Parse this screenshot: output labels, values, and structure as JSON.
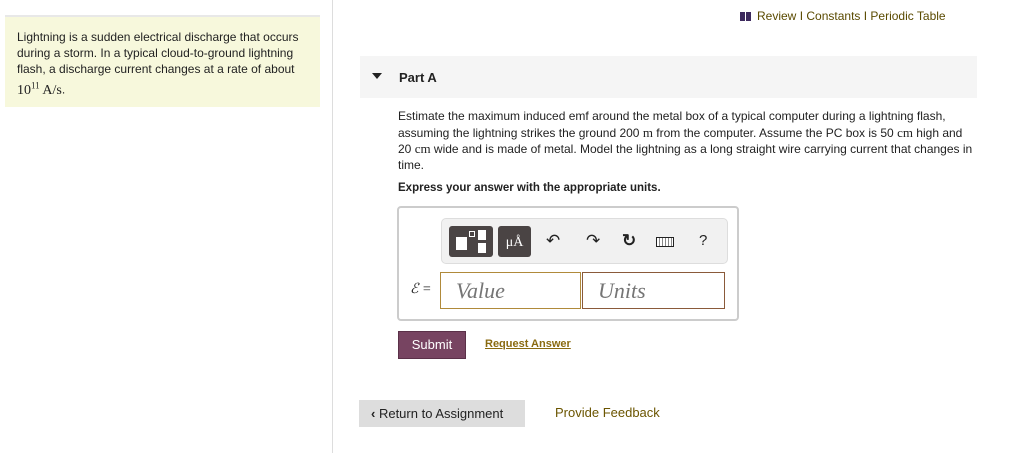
{
  "intro": {
    "text": "Lightning is a sudden electrical discharge that occurs during a storm. In a typical cloud-to-ground lightning flash, a discharge current changes at a rate of about ",
    "math_base": "10",
    "math_exp": "11",
    "math_unit": " A/s",
    "tail": "."
  },
  "toplinks": {
    "review": "Review",
    "sep": " I ",
    "constants": "Constants",
    "periodic": "Periodic Table"
  },
  "part": {
    "title": "Part A"
  },
  "question": {
    "p1": "Estimate the maximum induced emf around the metal box of a typical computer during a lightning flash, assuming the lightning strikes the ground 200 ",
    "u1": "m",
    "p2": " from the computer. Assume the PC box is 50 ",
    "u2": "cm",
    "p3": " high and 20 ",
    "u3": "cm",
    "p4": " wide and is made of metal. Model the lightning as a long straight wire carrying current that changes in time."
  },
  "express": "Express your answer with the appropriate units.",
  "toolbar": {
    "units_label": "μÅ",
    "help": "?"
  },
  "answer": {
    "label": "ℰ =",
    "value_placeholder": "Value",
    "units_placeholder": "Units"
  },
  "submit": "Submit",
  "request_answer": "Request Answer",
  "return": "Return to Assignment",
  "feedback": "Provide Feedback"
}
